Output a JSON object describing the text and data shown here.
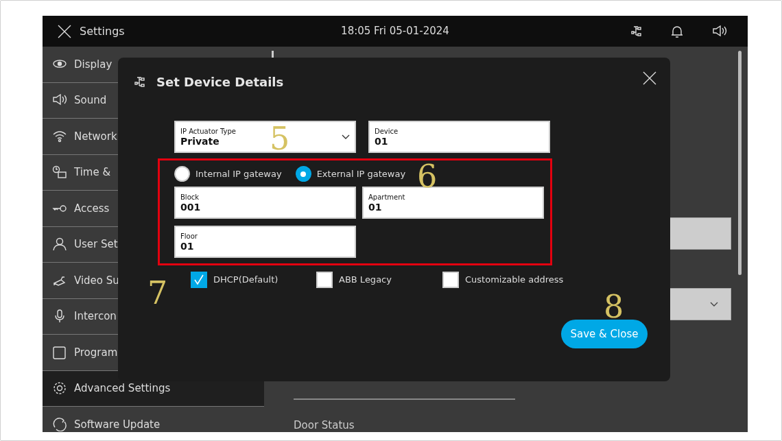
{
  "top_bar": {
    "title": "Settings",
    "datetime": "18:05  Fri 05-01-2024"
  },
  "sidebar": {
    "items": [
      {
        "label": "Display",
        "selected": false
      },
      {
        "label": "Sound",
        "selected": false
      },
      {
        "label": "Network",
        "selected": false
      },
      {
        "label": "Time &",
        "selected": false
      },
      {
        "label": "Access",
        "selected": false
      },
      {
        "label": "User Set",
        "selected": false
      },
      {
        "label": "Video Su",
        "selected": false
      },
      {
        "label": "Intercon",
        "selected": false
      },
      {
        "label": "Program",
        "selected": false
      },
      {
        "label": "Advanced Settings",
        "selected": true
      },
      {
        "label": "Software Update",
        "selected": false
      }
    ]
  },
  "content": {
    "door_status_label": "Door Status"
  },
  "dialog": {
    "title": "Set Device Details",
    "fields": [
      {
        "kind": "select",
        "label": "IP Actuator Type",
        "value": "Private"
      },
      {
        "kind": "text",
        "label": "Device",
        "value": "01"
      }
    ],
    "gateway_options": [
      {
        "label": "Internal IP gateway",
        "selected": false
      },
      {
        "label": "External IP gateway",
        "selected": true
      }
    ],
    "address_fields": [
      {
        "label": "Block",
        "value": "001"
      },
      {
        "label": "Apartment",
        "value": "01"
      },
      {
        "label": "Floor",
        "value": "01"
      }
    ],
    "options": [
      {
        "label": "DHCP(Default)",
        "checked": true
      },
      {
        "label": "ABB Legacy",
        "checked": false
      },
      {
        "label": "Customizable address",
        "checked": false
      }
    ],
    "save_button": "Save & Close"
  },
  "annotations": [
    "5",
    "6",
    "7",
    "8"
  ]
}
